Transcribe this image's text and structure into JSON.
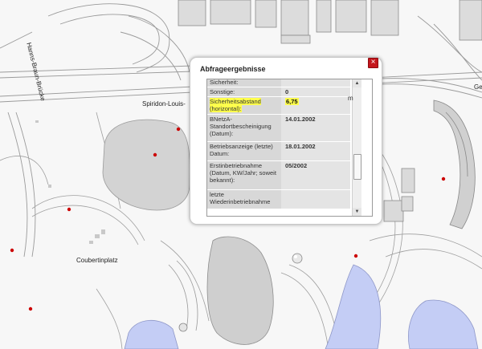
{
  "map": {
    "labels": {
      "bridge": "Hanns-Braun-Brücke",
      "street": "Spiridon-Louis-",
      "square": "Coubertinplatz",
      "edge": "Ge"
    },
    "colors": {
      "water": "#c4cdf5",
      "buildings": "#d4d4d4",
      "lines": "#9a9a9a",
      "markers": "#cc0000"
    }
  },
  "dialog": {
    "title": "Abfrageergebnisse",
    "close_icon": "close-icon",
    "rows": [
      {
        "label": "Sicherheit:",
        "value": ""
      },
      {
        "label": "Sonstige:",
        "value": "0"
      },
      {
        "label": "Sicherheitsabstand (horizontal):",
        "value": "6,75",
        "highlight": true
      },
      {
        "label": "BNetzA-Standortbescheinigung (Datum):",
        "value": "14.01.2002"
      },
      {
        "label": "Betriebsanzeige (letzte) Datum:",
        "value": "18.01.2002"
      },
      {
        "label": "Erstinbetriebnahme (Datum, KW/Jahr; soweit bekannt):",
        "value": "05/2002"
      },
      {
        "label": "letzte Wiederinbetriebnahme",
        "value": ""
      }
    ],
    "unit": "m",
    "scrollbar": {
      "up_icon": "arrow-up-icon",
      "down_icon": "arrow-down-icon"
    }
  }
}
